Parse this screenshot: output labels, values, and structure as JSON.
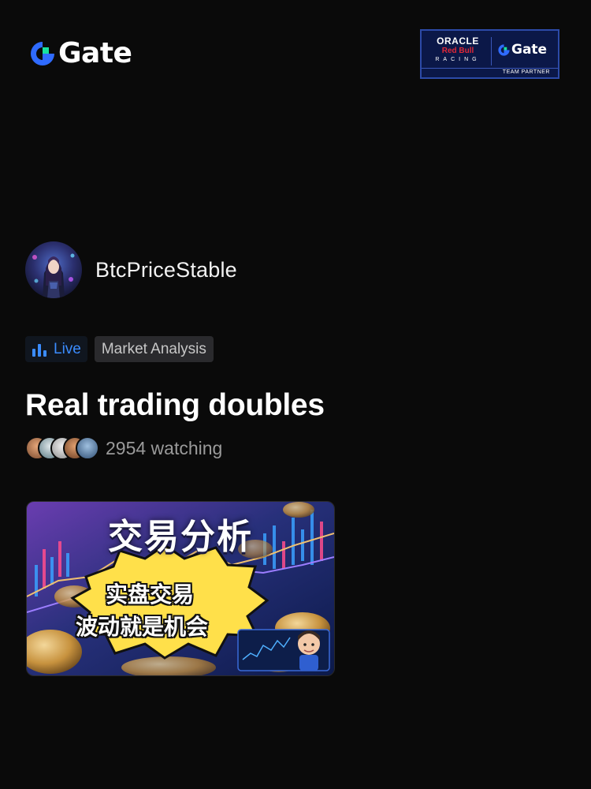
{
  "brand": {
    "name": "Gate",
    "accent_blue": "#2f6bff",
    "accent_green": "#17e2a0"
  },
  "partner_badge": {
    "oracle": "ORACLE",
    "red_bull": "Red Bull",
    "racing": "RACING",
    "gate": "Gate",
    "caption": "TEAM PARTNER"
  },
  "host": {
    "name": "BtcPriceStable",
    "avatar_icon": "avatar-anime-character"
  },
  "tags": {
    "live_label": "Live",
    "live_icon": "bar-chart-icon",
    "category": "Market Analysis"
  },
  "stream": {
    "title": "Real trading doubles",
    "watching_text": "2954 watching"
  },
  "thumbnail": {
    "headline": "交易分析",
    "line1": "实盘交易",
    "line2": "波动就是机会"
  }
}
